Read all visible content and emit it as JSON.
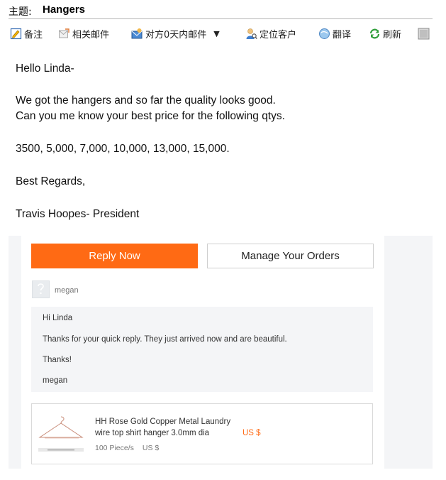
{
  "subject": {
    "label": "主题:",
    "value": "Hangers"
  },
  "toolbar": {
    "items": [
      {
        "label": "备注",
        "icon": "note-icon"
      },
      {
        "label": "相关邮件",
        "icon": "related-mail-icon"
      },
      {
        "label": "对方0天内邮件",
        "icon": "contact-mail-icon",
        "has_dropdown": true
      },
      {
        "label": "定位客户",
        "icon": "locate-customer-icon"
      },
      {
        "label": "翻译",
        "icon": "translate-icon"
      },
      {
        "label": "刷新",
        "icon": "refresh-icon"
      }
    ]
  },
  "email": {
    "greeting": "Hello Linda-",
    "line1": "We got the hangers and so far the quality looks good.",
    "line2": "Can you me know your best price for the following qtys.",
    "quantities": "3500, 5,000, 7,000, 10,000, 13,000, 15,000.",
    "closing": "Best Regards,",
    "signature": "Travis Hoopes- President"
  },
  "quoted": {
    "reply_button": "Reply Now",
    "manage_button": "Manage Your Orders",
    "sender": "megan",
    "message": {
      "line1": "Hi Linda",
      "line2": "Thanks for your quick reply. They just arrived now and are beautiful.",
      "line3": "Thanks!",
      "line4": "megan"
    },
    "product": {
      "title": "HH Rose Gold Copper Metal Laundry wire top shirt hanger 3.0mm dia",
      "price": "US $",
      "quantity": "100 Piece/s",
      "unit_price": "US $"
    }
  },
  "colors": {
    "accent": "#ff6a14",
    "panel_bg": "#f4f5f7",
    "refresh_green": "#2f9e3a"
  }
}
